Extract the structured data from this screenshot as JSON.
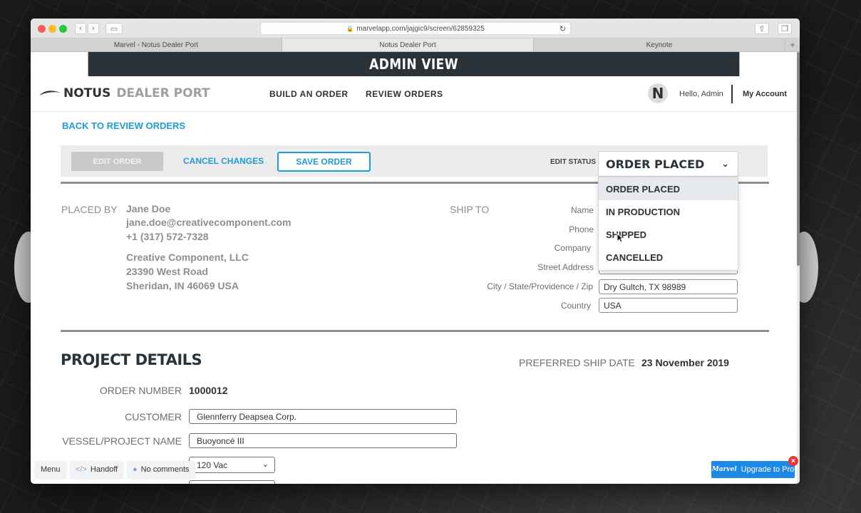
{
  "browser": {
    "url": "marvelapp.com/jajgic9/screen/62859325",
    "tabs": [
      "Marvel - Notus Dealer Port",
      "Notus Dealer Port",
      "Keynote"
    ],
    "new_tab": "+"
  },
  "admin_bar": {
    "title": "ADMIN VIEW"
  },
  "header": {
    "logo_brand": "NOTUS",
    "logo_sub": "DEALER PORT",
    "nav": [
      "BUILD AN ORDER",
      "REVIEW ORDERS"
    ],
    "avatar_letter": "N",
    "greeting": "Hello, Admin",
    "account": "My Account"
  },
  "back_link": "BACK TO REVIEW ORDERS",
  "actions": {
    "edit_order": "EDIT ORDER",
    "cancel_changes": "CANCEL CHANGES",
    "save_order": "SAVE ORDER",
    "edit_status_label": "EDIT STATUS",
    "status_value": "ORDER PLACED",
    "status_options": [
      "ORDER PLACED",
      "IN PRODUCTION",
      "SHIPPED",
      "CANCELLED"
    ]
  },
  "placed_by": {
    "label": "PLACED BY",
    "name": "Jane Doe",
    "email": "jane.doe@creativecomponent.com",
    "phone": "+1 (317) 572-7328",
    "company": "Creative Component, LLC",
    "street": "23390 West Road",
    "city": "Sheridan, IN 46069 USA"
  },
  "ship_to": {
    "label": "SHIP TO",
    "fields": [
      {
        "label": "Name",
        "value": ""
      },
      {
        "label": "Phone",
        "value": ""
      },
      {
        "label": "Company",
        "value": ""
      },
      {
        "label": "Street Address",
        "value": ""
      },
      {
        "label": "City / State/Providence / Zip",
        "value": "Dry Gultch, TX 98989"
      },
      {
        "label": "Country",
        "value": "USA"
      }
    ]
  },
  "project": {
    "title": "PROJECT DETAILS",
    "preferred_ship_label": "PREFERRED SHIP DATE",
    "preferred_ship_value": "23 November 2019",
    "order_number_label": "ORDER NUMBER",
    "order_number": "1000012",
    "customer_label": "CUSTOMER",
    "customer": "Glennferry Deapsea Corp.",
    "vessel_label": "VESSEL/PROJECT NAME",
    "vessel": "Buoyoncé III",
    "voltage": "120 Vac"
  },
  "marvel": {
    "menu": "Menu",
    "handoff": "Handoff",
    "comments": "No comments",
    "upgrade": "Upgrade to Pro",
    "upgrade_logo": "Marvel",
    "close": "×"
  }
}
